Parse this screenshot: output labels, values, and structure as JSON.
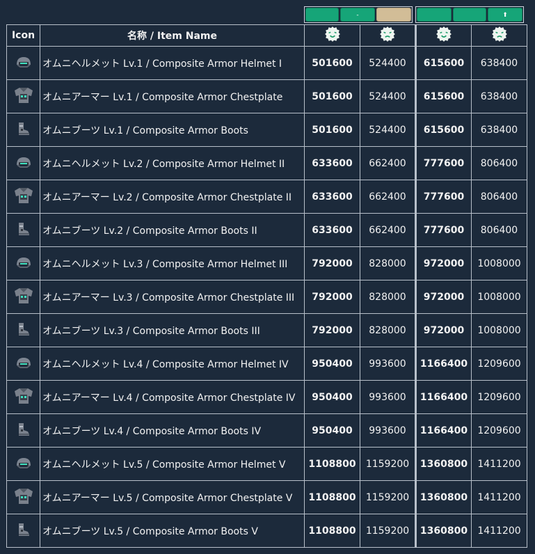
{
  "toolbar": {
    "group1": [
      {
        "label": ""
      },
      {
        "label": "-"
      },
      {
        "label": ""
      }
    ],
    "group2": [
      {
        "label": ""
      },
      {
        "label": ""
      },
      {
        "label": "⬆"
      }
    ]
  },
  "header": {
    "icon": "Icon",
    "name": "名称 / Item Name",
    "face_icons": [
      "happy-face-icon",
      "sad-face-icon",
      "happy-face-icon",
      "sad-face-icon"
    ]
  },
  "rows": [
    {
      "icon": "helmet-icon",
      "name": "オムニヘルメット Lv.1 / Composite Armor Helmet I",
      "v": [
        "501600",
        "524400",
        "615600",
        "638400"
      ]
    },
    {
      "icon": "chestplate-icon",
      "name": "オムニアーマー Lv.1 / Composite Armor Chestplate",
      "v": [
        "501600",
        "524400",
        "615600",
        "638400"
      ]
    },
    {
      "icon": "boots-icon",
      "name": "オムニブーツ Lv.1 / Composite Armor Boots",
      "v": [
        "501600",
        "524400",
        "615600",
        "638400"
      ]
    },
    {
      "icon": "helmet-icon",
      "name": "オムニヘルメット Lv.2 / Composite Armor Helmet  II",
      "v": [
        "633600",
        "662400",
        "777600",
        "806400"
      ]
    },
    {
      "icon": "chestplate-icon",
      "name": "オムニアーマー Lv.2 / Composite Armor Chestplate II",
      "v": [
        "633600",
        "662400",
        "777600",
        "806400"
      ]
    },
    {
      "icon": "boots-icon",
      "name": "オムニブーツ Lv.2 / Composite Armor Boots II",
      "v": [
        "633600",
        "662400",
        "777600",
        "806400"
      ]
    },
    {
      "icon": "helmet-icon",
      "name": "オムニヘルメット Lv.3 / Composite Armor Helmet  III",
      "v": [
        "792000",
        "828000",
        "972000",
        "1008000"
      ]
    },
    {
      "icon": "chestplate-icon",
      "name": "オムニアーマー Lv.3 / Composite Armor Chestplate III",
      "v": [
        "792000",
        "828000",
        "972000",
        "1008000"
      ]
    },
    {
      "icon": "boots-icon",
      "name": "オムニブーツ Lv.3 / Composite Armor Boots III",
      "v": [
        "792000",
        "828000",
        "972000",
        "1008000"
      ]
    },
    {
      "icon": "helmet-icon",
      "name": "オムニヘルメット Lv.4 / Composite Armor Helmet  IV",
      "v": [
        "950400",
        "993600",
        "1166400",
        "1209600"
      ]
    },
    {
      "icon": "chestplate-icon",
      "name": "オムニアーマー Lv.4 / Composite Armor Chestplate IV",
      "v": [
        "950400",
        "993600",
        "1166400",
        "1209600"
      ]
    },
    {
      "icon": "boots-icon",
      "name": "オムニブーツ Lv.4 / Composite Armor Boots IV",
      "v": [
        "950400",
        "993600",
        "1166400",
        "1209600"
      ]
    },
    {
      "icon": "helmet-icon",
      "name": "オムニヘルメット Lv.5 / Composite Armor Helmet  V",
      "v": [
        "1108800",
        "1159200",
        "1360800",
        "1411200"
      ]
    },
    {
      "icon": "chestplate-icon",
      "name": "オムニアーマー Lv.5 / Composite Armor Chestplate V",
      "v": [
        "1108800",
        "1159200",
        "1360800",
        "1411200"
      ]
    },
    {
      "icon": "boots-icon",
      "name": "オムニブーツ Lv.5 / Composite Armor Boots V",
      "v": [
        "1108800",
        "1159200",
        "1360800",
        "1411200"
      ]
    }
  ],
  "colors": {
    "background": "#1c2a3b",
    "grid": "#b8c0ca",
    "button_green": "#16a578",
    "button_beige": "#d2bd97",
    "face_fill": "#eef5f0",
    "face_feature": "#1f9c6a"
  }
}
